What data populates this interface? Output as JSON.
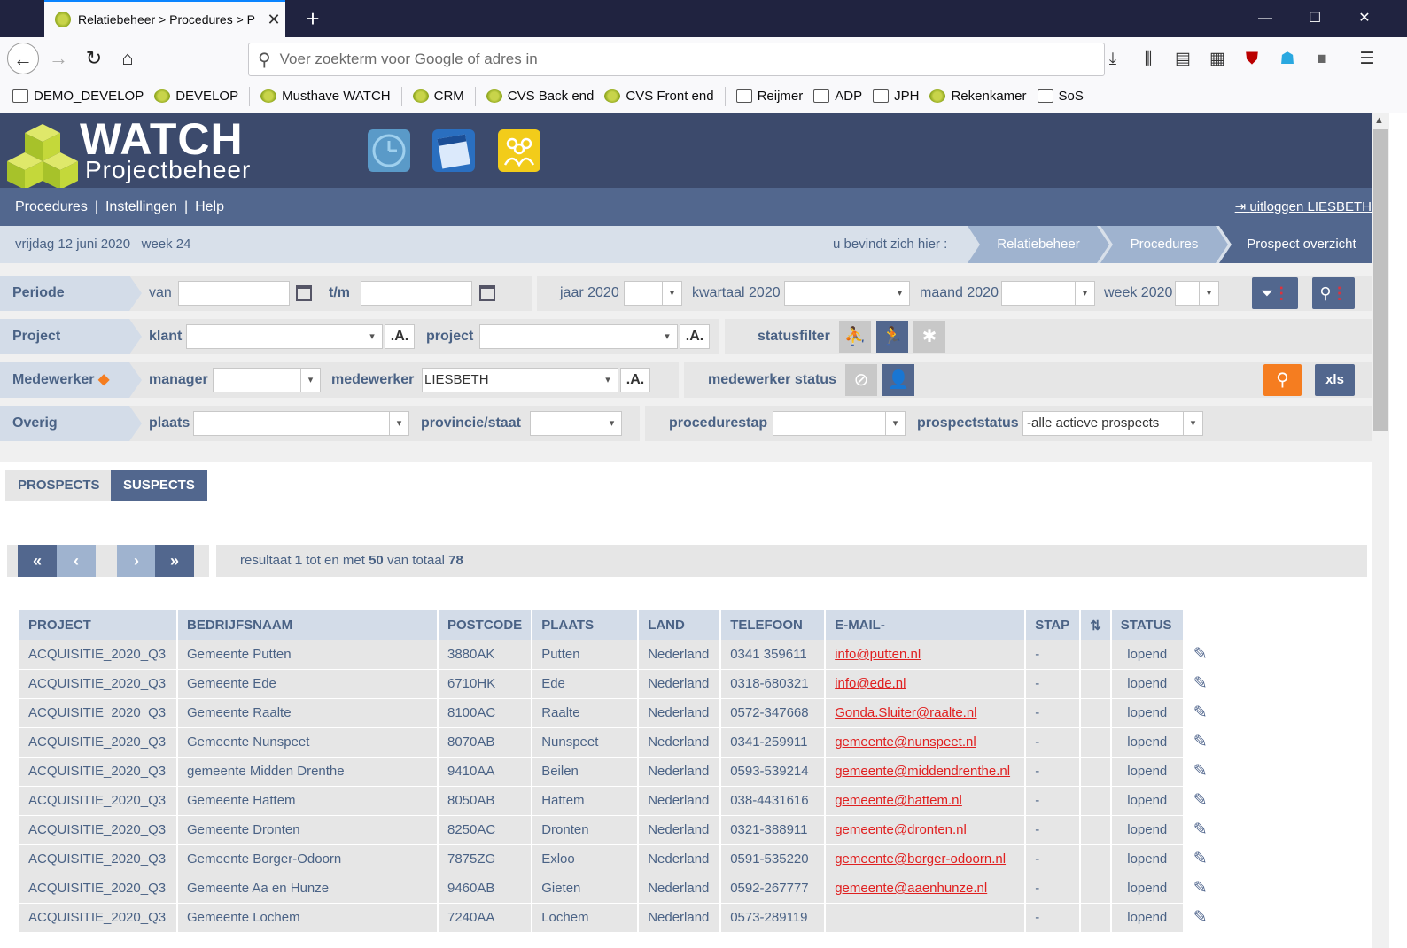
{
  "browser": {
    "tab_title": "Relatiebeheer > Procedures > P",
    "url_placeholder": "Voer zoekterm voor Google of adres in",
    "bookmarks": [
      "DEMO_DEVELOP",
      "DEVELOP",
      "Musthave WATCH",
      "CRM",
      "CVS Back end",
      "CVS Front end",
      "Reijmer",
      "ADP",
      "JPH",
      "Rekenkamer",
      "SoS"
    ]
  },
  "app": {
    "logo_title": "WATCH",
    "logo_subtitle": "Projectbeheer",
    "menu": [
      "Procedures",
      "Instellingen",
      "Help"
    ],
    "logout": "uitloggen LIESBETH",
    "date": "vrijdag 12 juni 2020",
    "week": "week 24",
    "where_label": "u bevindt zich hier :",
    "breadcrumbs": [
      "Relatiebeheer",
      "Procedures",
      "Prospect overzicht"
    ]
  },
  "filters": {
    "periode_label": "Periode",
    "van": "van",
    "tm": "t/m",
    "jaar": "jaar 2020",
    "kwartaal": "kwartaal 2020",
    "maand": "maand 2020",
    "week": "week 2020",
    "project_label": "Project",
    "klant": "klant",
    "project": "project",
    "statusfilter": "statusfilter",
    "medewerker_label": "Medewerker",
    "manager": "manager",
    "medewerker": "medewerker",
    "medewerker_value": "LIESBETH",
    "medewerker_status": "medewerker status",
    "xls": "xls",
    "overig_label": "Overig",
    "plaats": "plaats",
    "provincie": "provincie/staat",
    "procedurestap": "procedurestap",
    "prospectstatus": "prospectstatus",
    "prospectstatus_value": "-alle actieve prospects",
    "dotA": ".A."
  },
  "tabs": [
    "PROSPECTS",
    "SUSPECTS"
  ],
  "pager": {
    "text_pre": "resultaat ",
    "from": "1",
    "text_mid": " tot en met ",
    "to": "50",
    "text_mid2": " van totaal ",
    "total": "78"
  },
  "table": {
    "headers": [
      "PROJECT",
      "BEDRIJFSNAAM",
      "POSTCODE",
      "PLAATS",
      "LAND",
      "TELEFOON",
      "E-MAIL-",
      "STAP",
      "⇅",
      "STATUS"
    ],
    "rows": [
      {
        "project": "ACQUISITIE_2020_Q3",
        "bedrijf": "Gemeente Putten",
        "postcode": "3880AK",
        "plaats": "Putten",
        "land": "Nederland",
        "tel": "0341 359611",
        "email": "info@putten.nl",
        "stap": "-",
        "status": "lopend"
      },
      {
        "project": "ACQUISITIE_2020_Q3",
        "bedrijf": "Gemeente Ede",
        "postcode": "6710HK",
        "plaats": "Ede",
        "land": "Nederland",
        "tel": "0318-680321",
        "email": "info@ede.nl",
        "stap": "-",
        "status": "lopend"
      },
      {
        "project": "ACQUISITIE_2020_Q3",
        "bedrijf": "Gemeente Raalte",
        "postcode": "8100AC",
        "plaats": "Raalte",
        "land": "Nederland",
        "tel": "0572-347668",
        "email": "Gonda.Sluiter@raalte.nl",
        "stap": "-",
        "status": "lopend"
      },
      {
        "project": "ACQUISITIE_2020_Q3",
        "bedrijf": "Gemeente Nunspeet",
        "postcode": "8070AB",
        "plaats": "Nunspeet",
        "land": "Nederland",
        "tel": "0341-259911",
        "email": "gemeente@nunspeet.nl",
        "stap": "-",
        "status": "lopend"
      },
      {
        "project": "ACQUISITIE_2020_Q3",
        "bedrijf": "gemeente Midden Drenthe",
        "postcode": "9410AA",
        "plaats": "Beilen",
        "land": "Nederland",
        "tel": "0593-539214",
        "email": "gemeente@middendrenthe.nl",
        "stap": "-",
        "status": "lopend"
      },
      {
        "project": "ACQUISITIE_2020_Q3",
        "bedrijf": "Gemeente Hattem",
        "postcode": "8050AB",
        "plaats": "Hattem",
        "land": "Nederland",
        "tel": "038-4431616",
        "email": "gemeente@hattem.nl",
        "stap": "-",
        "status": "lopend"
      },
      {
        "project": "ACQUISITIE_2020_Q3",
        "bedrijf": "Gemeente Dronten",
        "postcode": "8250AC",
        "plaats": "Dronten",
        "land": "Nederland",
        "tel": "0321-388911",
        "email": "gemeente@dronten.nl",
        "stap": "-",
        "status": "lopend"
      },
      {
        "project": "ACQUISITIE_2020_Q3",
        "bedrijf": "Gemeente Borger-Odoorn",
        "postcode": "7875ZG",
        "plaats": "Exloo",
        "land": "Nederland",
        "tel": "0591-535220",
        "email": "gemeente@borger-odoorn.nl",
        "stap": "-",
        "status": "lopend"
      },
      {
        "project": "ACQUISITIE_2020_Q3",
        "bedrijf": "Gemeente Aa en Hunze",
        "postcode": "9460AB",
        "plaats": "Gieten",
        "land": "Nederland",
        "tel": "0592-267777",
        "email": "gemeente@aaenhunze.nl",
        "stap": "-",
        "status": "lopend"
      },
      {
        "project": "ACQUISITIE_2020_Q3",
        "bedrijf": "Gemeente Lochem",
        "postcode": "7240AA",
        "plaats": "Lochem",
        "land": "Nederland",
        "tel": "0573-289119",
        "email": "",
        "stap": "-",
        "status": "lopend"
      }
    ]
  },
  "colors": {
    "header_dark": "#3c4a6c",
    "menu_blue": "#52678e",
    "accent_orange": "#f57d20",
    "email_red": "#e02020"
  }
}
